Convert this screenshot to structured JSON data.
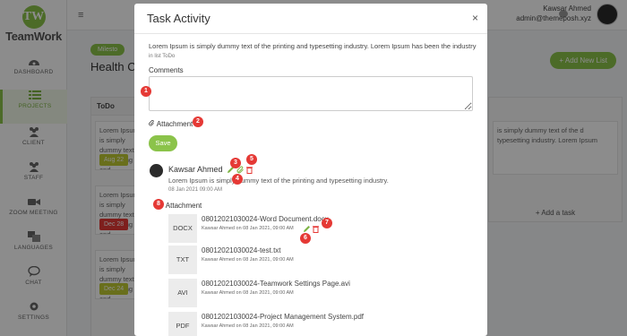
{
  "app": {
    "logo_letters": "TW",
    "logo_text": "TeamWork"
  },
  "sidebar": {
    "items": [
      {
        "label": "DASHBOARD",
        "icon": "dashboard-icon"
      },
      {
        "label": "PROJECTS",
        "icon": "list-icon",
        "active": true
      },
      {
        "label": "CLIENT",
        "icon": "users-icon"
      },
      {
        "label": "STAFF",
        "icon": "users-icon"
      },
      {
        "label": "ZOOM MEETING",
        "icon": "video-icon"
      },
      {
        "label": "LANGUAGES",
        "icon": "languages-icon"
      },
      {
        "label": "CHAT",
        "icon": "chat-icon"
      },
      {
        "label": "SETTINGS",
        "icon": "gear-icon"
      }
    ]
  },
  "topbar": {
    "menu_glyph": "≡",
    "user_name": "Kawsar Ahmed",
    "user_email": "admin@themeposh.xyz"
  },
  "background": {
    "milestone_label": "Milesto",
    "project_title": "Health Co",
    "add_list_label": "+ Add New List",
    "todo_header": "ToDo",
    "card_text": "Lorem Ipsum is simply dummy text of the printing and typesetting industry. Lorem Ipsum has been the",
    "card_text_right": "is simply dummy text of the d typesetting industry. Lorem Ipsum",
    "badges": [
      {
        "label": "Aug 22",
        "color": "#c0ca33"
      },
      {
        "label": "Dec 28",
        "color": "#e53935"
      },
      {
        "label": "Dec 24",
        "color": "#c0ca33"
      }
    ],
    "add_task_label": "+ Add a task"
  },
  "modal": {
    "title": "Task Activity",
    "close_glyph": "×",
    "description": "Lorem Ipsum is simply dummy text of the printing and typesetting industry. Lorem Ipsum has been the industry",
    "in_list": "in list ToDo",
    "comments_label": "Comments",
    "comment_value": "",
    "attachment_label": "Attachment",
    "save_label": "Save",
    "comment": {
      "author": "Kawsar Ahmed",
      "text": "Lorem Ipsum is simply dummy text of the printing and typesetting industry.",
      "date": "08 Jan 2021 09:00 AM"
    },
    "attachments_label": "Attachment",
    "files": [
      {
        "type": "DOCX",
        "name": "08012021030024-Word Document.docx",
        "meta": "Kawsar Ahmed on 08 Jan 2021, 09:00 AM"
      },
      {
        "type": "TXT",
        "name": "08012021030024-test.txt",
        "meta": "Kawsar Ahmed on 08 Jan 2021, 09:00 AM"
      },
      {
        "type": "AVI",
        "name": "08012021030024-Teamwork Settings Page.avi",
        "meta": "Kawsar Ahmed on 08 Jan 2021, 09:00 AM"
      },
      {
        "type": "PDF",
        "name": "08012021030024-Project Management System.pdf",
        "meta": "Kawsar Ahmed on 08 Jan 2021, 09:00 AM"
      }
    ]
  },
  "markers": [
    "1",
    "2",
    "3",
    "4",
    "5",
    "6",
    "7",
    "8"
  ],
  "colors": {
    "accent": "#8bc34a",
    "marker": "#e53935",
    "edit": "#7cb342",
    "delete": "#e53935"
  }
}
